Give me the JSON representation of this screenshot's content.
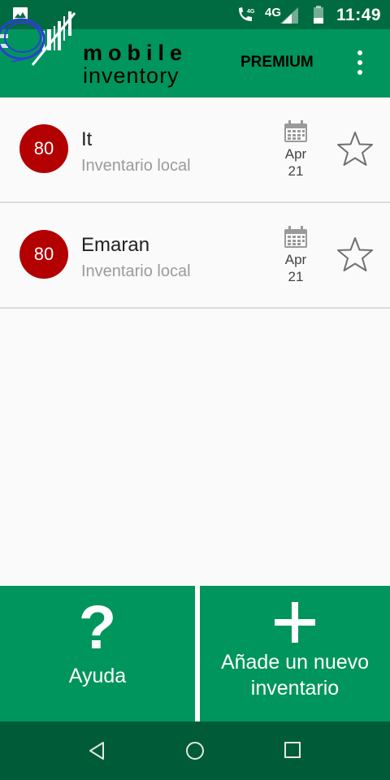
{
  "status_bar": {
    "network": "4G",
    "time": "11:49"
  },
  "app_bar": {
    "logo_line1": "mobile",
    "logo_line2": "inventory",
    "premium_label": "PREMIUM"
  },
  "inventories": [
    {
      "count": "80",
      "name": "It",
      "type": "Inventario local",
      "month": "Apr",
      "day": "21"
    },
    {
      "count": "80",
      "name": "Emaran",
      "type": "Inventario local",
      "month": "Apr",
      "day": "21"
    }
  ],
  "actions": {
    "help_icon": "?",
    "help_label": "Ayuda",
    "add_label": "Añade un nuevo inventario"
  },
  "colors": {
    "status_bar": "#006b40",
    "primary": "#00955c",
    "badge": "#b30000",
    "nav_bar": "#005c38"
  }
}
